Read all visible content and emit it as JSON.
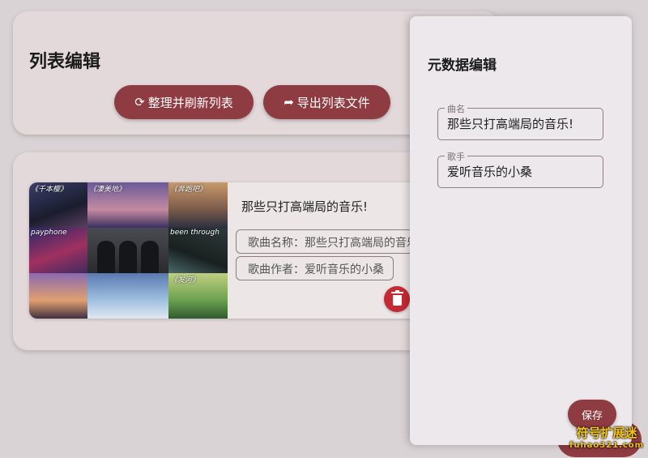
{
  "list_editor": {
    "title": "列表编辑",
    "refresh_label": "整理并刷新列表",
    "export_label": "导出列表文件"
  },
  "song_item": {
    "title": "那些只打高端局的音乐!",
    "name_field": "歌曲名称：那些只打高端局的音乐",
    "author_field": "歌曲作者：爱听音乐的小桑",
    "cover_labels": [
      "《千本樱》",
      "《凄美地》",
      "《奔跑吧》",
      "payphone",
      "",
      "been through",
      "",
      "",
      "《发河》"
    ]
  },
  "metadata_panel": {
    "title": "元数据编辑",
    "song_label": "曲名",
    "song_value": "那些只打高端局的音乐!",
    "artist_label": "歌手",
    "artist_value": "爱听音乐的小桑",
    "save_label": "保存"
  },
  "watermark": {
    "line1": "符号扩展迷",
    "line2": "fuhao321.com"
  },
  "icons": {
    "refresh": "refresh-icon",
    "export": "share-arrow-icon",
    "delete": "trash-icon"
  },
  "colors": {
    "accent": "#8e3b41",
    "danger": "#c42a34",
    "card": "#e3d9da",
    "panel": "#ede8ec"
  }
}
